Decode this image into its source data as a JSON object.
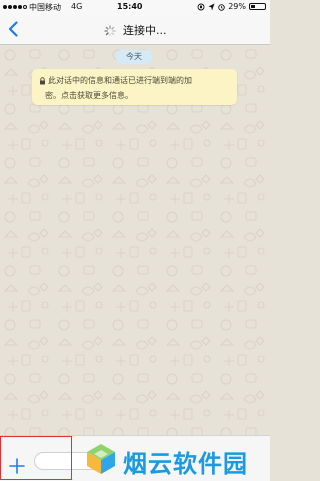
{
  "status_bar": {
    "carrier": "中国移动",
    "network": "4G",
    "time": "15:40",
    "battery": "29%",
    "battery_level": 0.29
  },
  "nav": {
    "title": "连接中..."
  },
  "chat": {
    "date_label": "今天",
    "encryption_notice_line1": "此对话中的信息和通话已进行端到端的加",
    "encryption_notice_line2": "密。点击获取更多信息。"
  },
  "input": {
    "plus_label": "+",
    "placeholder": ""
  },
  "watermark": {
    "text": "烟云软件园"
  },
  "colors": {
    "accent": "#1f7bf2",
    "wallpaper": "#e7e2d8",
    "date_chip": "#d4eaf4",
    "notice_bg": "#fcf4c4",
    "highlight": "#e23030",
    "watermark": "#1a9ae0"
  }
}
